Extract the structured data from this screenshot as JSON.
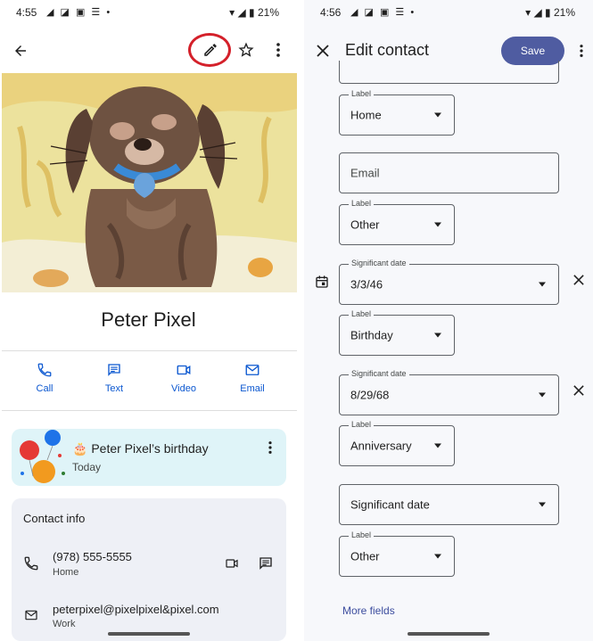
{
  "left": {
    "status": {
      "time": "4:55",
      "notif_icons": "◢ ◪ ▣ ☰ •",
      "battery": "21%"
    },
    "contact_name": "Peter Pixel",
    "actions": [
      {
        "label": "Call"
      },
      {
        "label": "Text"
      },
      {
        "label": "Video"
      },
      {
        "label": "Email"
      }
    ],
    "birthday": {
      "emoji": "🎂",
      "title": "Peter Pixel’s birthday",
      "subtitle": "Today"
    },
    "contact_info": {
      "header": "Contact info",
      "phone": {
        "value": "(978) 555-5555",
        "type": "Home"
      },
      "email": {
        "value": "peterpixel@pixelpixel&pixel.com",
        "type": "Work"
      }
    },
    "highlight_color": "#d4202a"
  },
  "right": {
    "status": {
      "time": "4:56",
      "notif_icons": "◢ ◪ ▣ ☰ •",
      "battery": "21%"
    },
    "title": "Edit contact",
    "save_label": "Save",
    "fields": {
      "label_home": {
        "label": "Label",
        "value": "Home"
      },
      "email": {
        "placeholder": "Email"
      },
      "label_other_1": {
        "label": "Label",
        "value": "Other"
      },
      "sig_date_1": {
        "label": "Significant date",
        "value": "3/3/46"
      },
      "label_birthday": {
        "label": "Label",
        "value": "Birthday"
      },
      "sig_date_2": {
        "label": "Significant date",
        "value": "8/29/68"
      },
      "label_anniversary": {
        "label": "Label",
        "value": "Anniversary"
      },
      "sig_date_3": {
        "placeholder": "Significant date"
      },
      "label_other_2": {
        "label": "Label",
        "value": "Other"
      }
    },
    "more_fields": "More fields",
    "accent": "#4f5ca1"
  }
}
